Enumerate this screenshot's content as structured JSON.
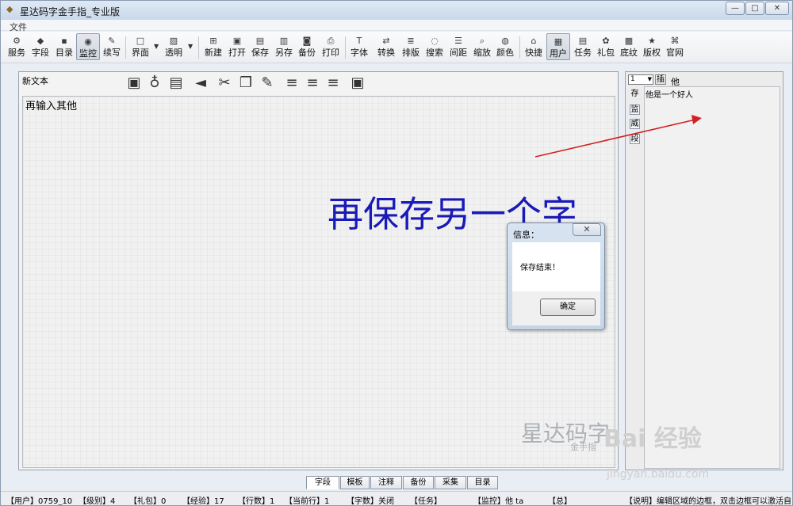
{
  "window": {
    "title": "星达码字金手指_专业版",
    "minimize": "—",
    "maximize": "□",
    "close": "✕"
  },
  "menu": {
    "file": "文件"
  },
  "toolbar": {
    "service": "服务",
    "field": "字段",
    "catalog": "目录",
    "monitor": "监控",
    "continue": "续写",
    "interface": "界面",
    "transparent": "透明",
    "new": "新建",
    "open": "打开",
    "save": "保存",
    "save_as": "另存",
    "backup": "备份",
    "print": "打印",
    "font": "字体",
    "convert": "转换",
    "layout": "排版",
    "search": "搜索",
    "spacing": "间距",
    "zoom": "缩放",
    "color": "颜色",
    "shortcut": "快捷",
    "user": "用户",
    "task": "任务",
    "gift": "礼包",
    "texture": "底纹",
    "copyright": "版权",
    "website": "官网"
  },
  "editor": {
    "doc_title": "新文本",
    "text": "再输入其他",
    "overlay_text": "再保存另一个字",
    "watermark_logo": "星达码字",
    "watermark_sub": "金手指"
  },
  "dialog": {
    "title": "信息：",
    "message": "保存结束！",
    "ok": "确定"
  },
  "right_panel": {
    "select_value": "1",
    "insert": "插",
    "char": "他",
    "side_save": "存",
    "side_monitor": "监",
    "side_power": "威",
    "side_field": "段",
    "content": "他是一个好人"
  },
  "bottom_tabs": [
    "字段",
    "模板",
    "注释",
    "备份",
    "采集",
    "目录"
  ],
  "status": {
    "user": "【用户】0759_10",
    "level": "【级别】4",
    "gift": "【礼包】0",
    "exp": "【经验】17",
    "lines": "【行数】1",
    "current_line": "【当前行】1",
    "char_count": "【字数】关闭",
    "task": "【任务】",
    "monitor": "【监控】他 ta",
    "total": "【总】",
    "note": "【说明】编辑区域的边框，双击边框可以激活自"
  },
  "watermark": {
    "baidu": "Bai 经验",
    "url": "jingyan.baidu.com"
  },
  "colors": {
    "overlay_text": "#1a1ab8",
    "arrow": "#d42020"
  }
}
